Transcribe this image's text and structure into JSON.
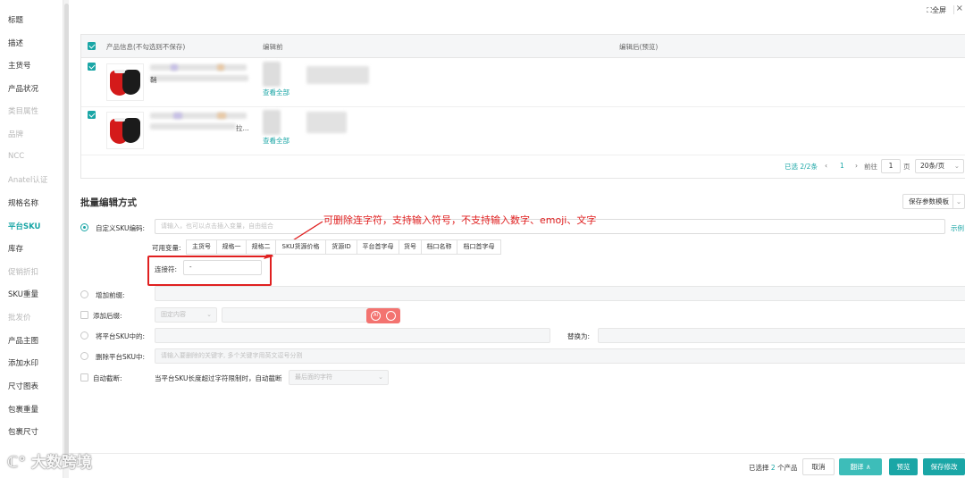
{
  "sidebar": {
    "items": [
      {
        "label": "标题",
        "state": "normal"
      },
      {
        "label": "描述",
        "state": "normal"
      },
      {
        "label": "主货号",
        "state": "normal"
      },
      {
        "label": "产品状况",
        "state": "normal"
      },
      {
        "label": "类目属性",
        "state": "muted"
      },
      {
        "label": "品牌",
        "state": "muted"
      },
      {
        "label": "NCC",
        "state": "muted"
      },
      {
        "label": "Anatel认证",
        "state": "muted"
      },
      {
        "label": "规格名称",
        "state": "normal"
      },
      {
        "label": "平台SKU",
        "state": "active"
      },
      {
        "label": "库存",
        "state": "normal"
      },
      {
        "label": "促销折扣",
        "state": "muted"
      },
      {
        "label": "SKU重量",
        "state": "normal"
      },
      {
        "label": "批发价",
        "state": "muted"
      },
      {
        "label": "产品主图",
        "state": "normal"
      },
      {
        "label": "添加水印",
        "state": "normal"
      },
      {
        "label": "尺寸图表",
        "state": "normal"
      },
      {
        "label": "包裹重量",
        "state": "normal"
      },
      {
        "label": "包裹尺寸",
        "state": "normal"
      }
    ]
  },
  "topbar": {
    "fullscreen": "全屏",
    "close": "×"
  },
  "table": {
    "headers": {
      "product": "产品信息(不勾选则不保存)",
      "before": "编辑前",
      "after": "编辑后(预览)"
    },
    "rows": [
      {
        "view_all": "查看全部",
        "name_tail": "鞘",
        "checked": true
      },
      {
        "view_all": "查看全部",
        "name_tail": "拉...",
        "checked": true
      }
    ]
  },
  "pagination": {
    "selected": "已选 2/2条",
    "prev": "‹",
    "page": "1",
    "next": "›",
    "goto": "前往",
    "goto_value": "1",
    "page_unit": "页",
    "page_size": "20条/页"
  },
  "batch": {
    "title": "批量编辑方式",
    "template_button": "保存参数模板",
    "options": {
      "custom_sku": {
        "label": "自定义SKU编码:",
        "placeholder": "请输入，也可以点击插入变量，自由组合",
        "example": "示例"
      },
      "variables_label": "可用变量:",
      "variables": [
        "主货号",
        "规格一",
        "规格二",
        "SKU货源价格",
        "货源ID",
        "平台首字母",
        "货号",
        "档口名称",
        "档口首字母"
      ],
      "connector": {
        "label": "连接符:",
        "value": "-"
      },
      "add_prefix": {
        "label": "增加前缀:"
      },
      "add_suffix": {
        "label": "添加后缀:",
        "select_value": "固定内容"
      },
      "replace": {
        "label": "将平台SKU中的:",
        "replace_with": "替换为:"
      },
      "delete": {
        "label": "删除平台SKU中:",
        "placeholder": "请输入要删除的关键字, 多个关键字用英文逗号分割"
      },
      "auto_truncate": {
        "label": "自动截断:",
        "desc": "当平台SKU长度超过字符限制时，自动截断",
        "select_value": "最后面的字符"
      }
    },
    "annotation": "可删除连字符，支持输入符号，不支持输入数字、emoji、文字"
  },
  "footer": {
    "selected_prefix": "已选择",
    "selected_count": "2",
    "selected_suffix": "个产品",
    "cancel": "取消",
    "translate": "翻译 ∧",
    "preview": "预览",
    "save": "保存修改"
  },
  "watermark": "大数跨境",
  "colors": {
    "accent": "#1aa6a6",
    "annotation": "#e02020",
    "ai_badge": "#f37370"
  }
}
